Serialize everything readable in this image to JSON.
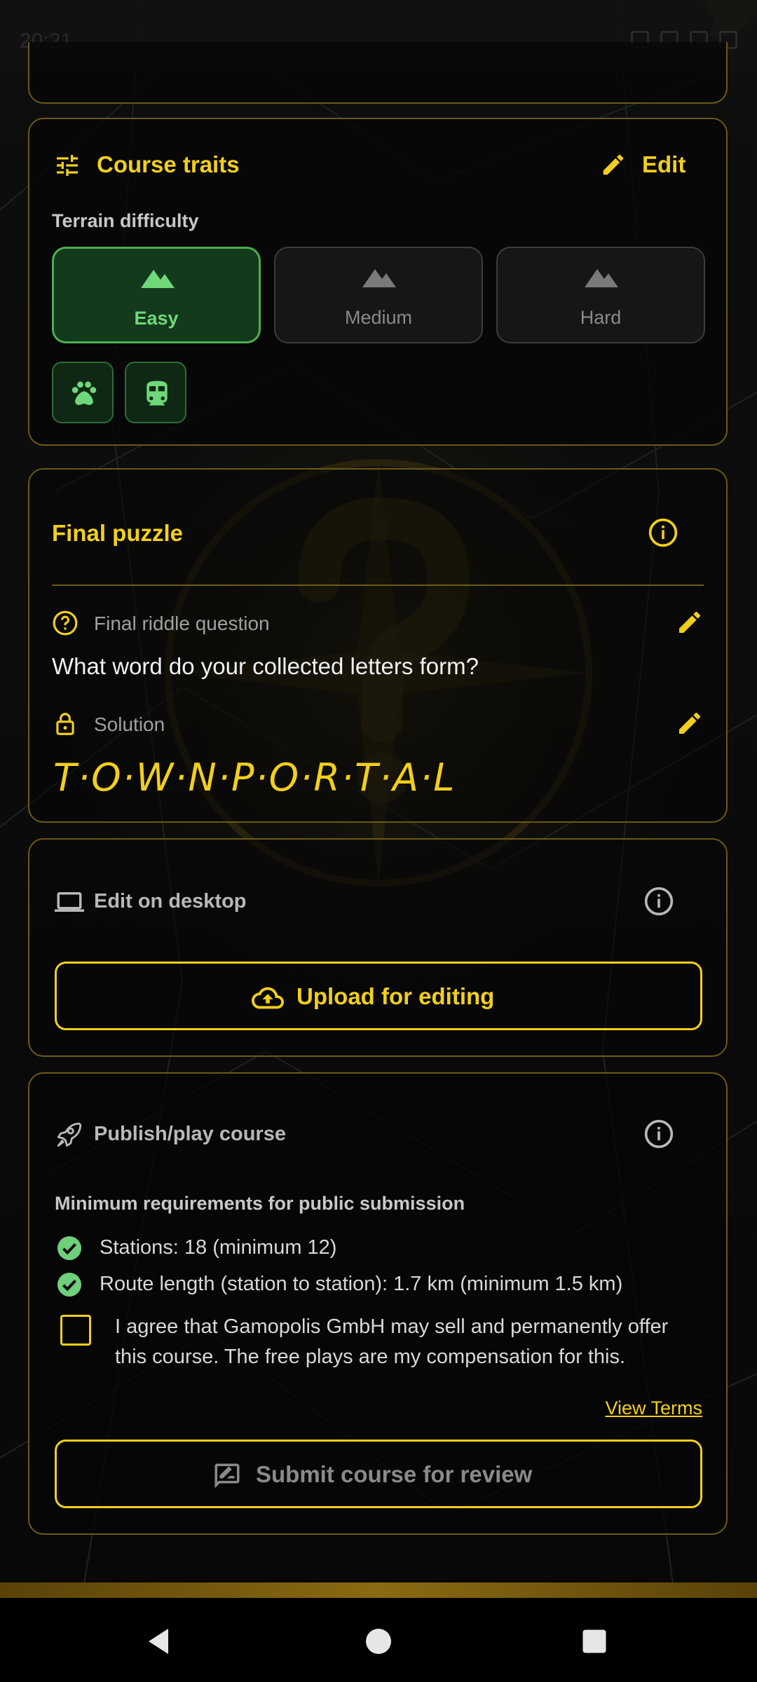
{
  "status_bar": {
    "time": "20:21"
  },
  "top_card": {
    "text": ""
  },
  "course_traits": {
    "title": "Course traits",
    "edit_label": "Edit",
    "terrain_label": "Terrain difficulty",
    "difficulties": [
      "Easy",
      "Medium",
      "Hard"
    ],
    "selected": "Easy",
    "traits": [
      "paw-icon",
      "train-icon"
    ]
  },
  "final_puzzle": {
    "title": "Final puzzle",
    "question_label": "Final riddle question",
    "question": "What word do your collected letters form?",
    "solution_label": "Solution",
    "solution": "T·O·W·N·P·O·R·T·A·L"
  },
  "desktop": {
    "title": "Edit on desktop",
    "upload_label": "Upload for editing"
  },
  "publish": {
    "title": "Publish/play course",
    "requirements_title": "Minimum requirements for public submission",
    "requirements": [
      "Stations: 18 (minimum 12)",
      "Route length (station to station): 1.7 km (minimum 1.5 km)"
    ],
    "agree_text": "I agree that Gamopolis GmbH may sell and permanently offer this course. The free plays are my compensation for this.",
    "agree_checked": false,
    "terms_link": "View Terms",
    "submit_label": "Submit course for review"
  },
  "colors": {
    "accent": "#f2cf1c",
    "success": "#4caf50",
    "background": "#070707"
  }
}
